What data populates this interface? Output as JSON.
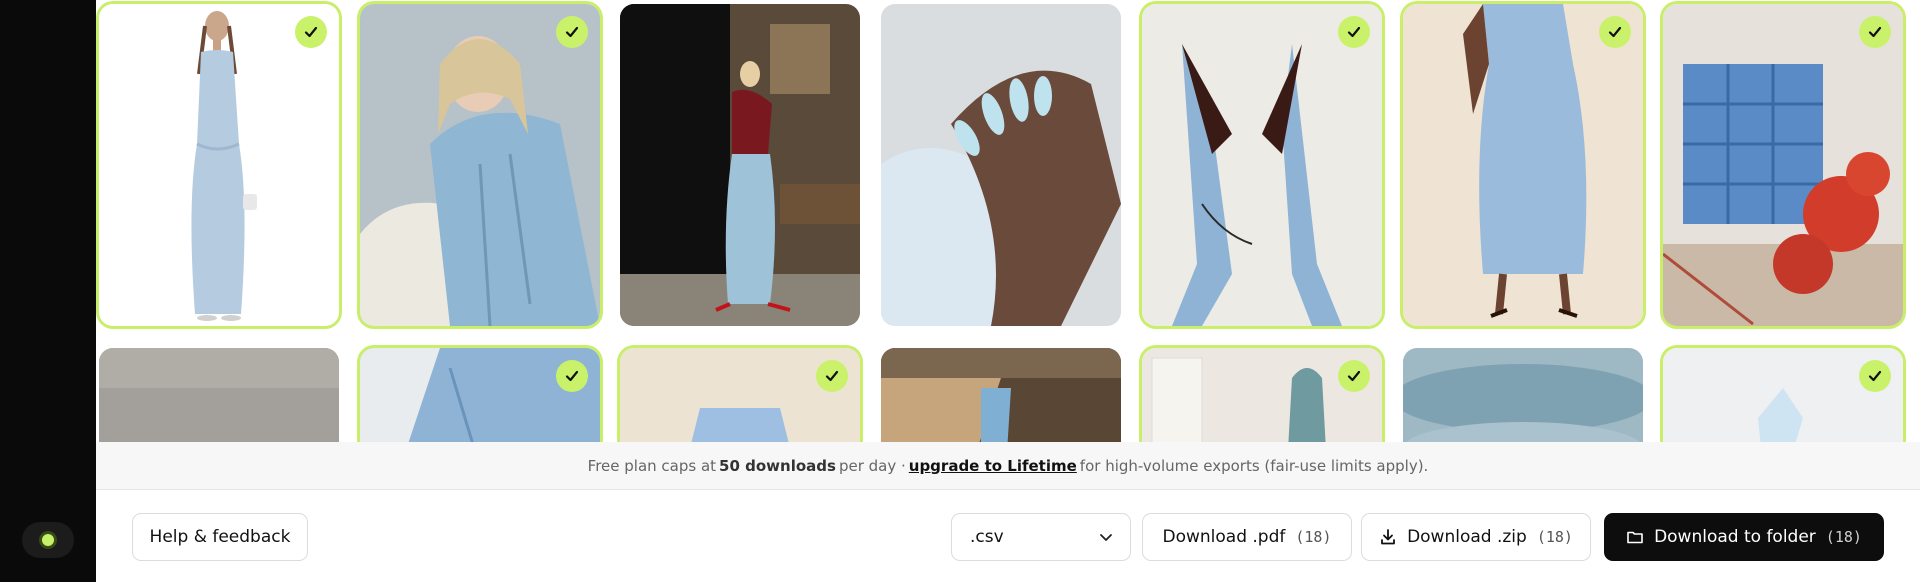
{
  "notice": {
    "prefix": "Free plan caps at",
    "limit": "50 downloads",
    "middle": "per day ·",
    "link": "upgrade to Lifetime",
    "suffix": "for high-volume exports (fair-use limits apply)."
  },
  "footer": {
    "help_label": "Help & feedback",
    "format_value": ".csv",
    "pdf_label": "Download .pdf",
    "pdf_count": "(18)",
    "zip_label": "Download .zip",
    "zip_count": "(18)",
    "folder_label": "Download to folder",
    "folder_count": "(18)"
  },
  "icons": {
    "check": "check-icon",
    "chevron": "chevron-down-icon",
    "download": "download-icon",
    "folder": "folder-icon",
    "status": "status-dot"
  },
  "colors": {
    "accent": "#c9f26a",
    "dark_button": "#0d0d0d",
    "rail": "#0a0a0a"
  },
  "gallery": {
    "row1_selected": [
      true,
      true,
      false,
      false,
      true,
      true,
      true
    ],
    "row2_selected": [
      false,
      true,
      true,
      false,
      true,
      false,
      true
    ]
  }
}
